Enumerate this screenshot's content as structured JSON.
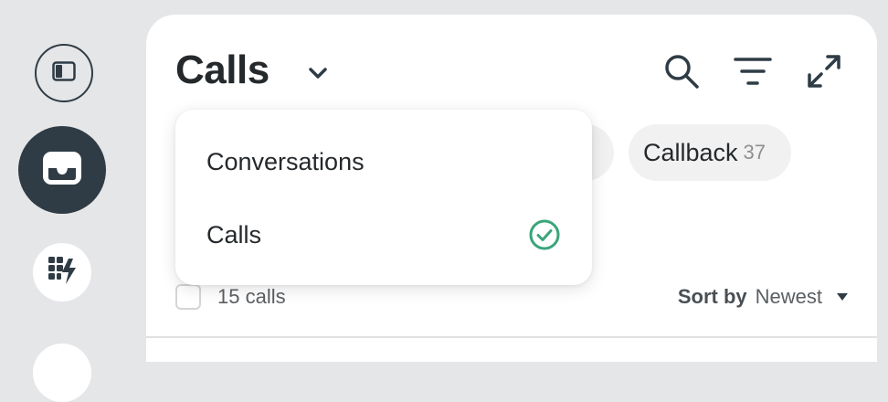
{
  "header": {
    "title": "Calls"
  },
  "filters": {
    "hidden_chip_partial": "0",
    "callback": {
      "label": "Callback",
      "count": "37"
    }
  },
  "list": {
    "count_label": "15 calls",
    "sort_label": "Sort by",
    "sort_value": "Newest"
  },
  "dropdown": {
    "items": [
      {
        "label": "Conversations",
        "selected": false
      },
      {
        "label": "Calls",
        "selected": true
      }
    ]
  },
  "icons": {
    "sidebar": [
      "sidebar-toggle-icon",
      "inbox-icon",
      "dialer-bolt-icon"
    ],
    "toolbar": [
      "search-icon",
      "filter-icon",
      "expand-icon"
    ],
    "check": "check-circle-icon"
  },
  "colors": {
    "sidebar_active": "#2f3c45",
    "accent_check": "#3aa57a",
    "background": "#e5e6e8"
  }
}
